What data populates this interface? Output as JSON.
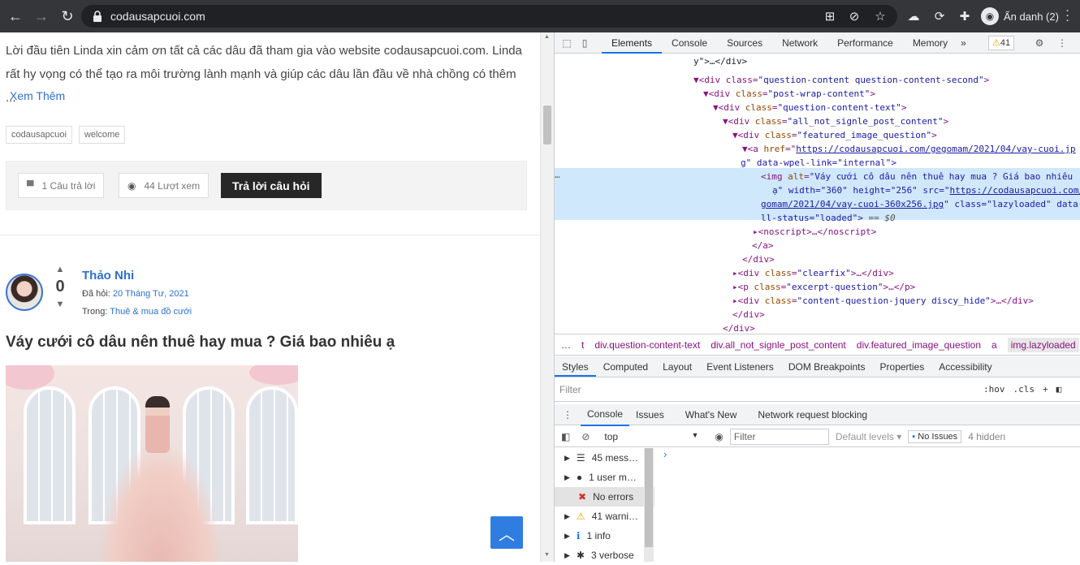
{
  "browser": {
    "url": "codausapcuoi.com",
    "profile_label": "Ẩn danh (2)"
  },
  "page": {
    "intro_text": "Lời đầu tiên Linda xin cảm ơn tất cả các dâu đã tham gia vào website codausapcuoi.com. Linda rất hy vọng có thể tạo ra môi trường lành mạnh và giúp các dâu lần đầu về nhà chồng có thêm ...",
    "read_more": "Xem Thêm",
    "tags": [
      "codausapcuoi",
      "welcome"
    ],
    "answers_btn": "1 Câu trả lời",
    "views_btn": "44 Lượt xem",
    "answer_btn": "Trả lời câu hỏi",
    "author": "Thảo Nhi",
    "vote_count": "0",
    "asked_label": "Đã hỏi:",
    "asked_date": "20 Tháng Tư, 2021",
    "in_label": "Trong:",
    "category": "Thuê & mua đồ cưới",
    "question_title": "Váy cưới cô dâu nên thuê hay mua ? Giá bao nhiêu ạ"
  },
  "devtools": {
    "tabs": [
      "Elements",
      "Console",
      "Sources",
      "Network",
      "Performance",
      "Memory"
    ],
    "more": "»",
    "warn_count": "41",
    "dom": {
      "l0": "y\">…</div>",
      "l1_tag": "<div class=",
      "l1_val": "\"question-content question-content-second\"",
      "l2_val": "\"post-wrap-content\"",
      "l3_val": "\"question-content-text\"",
      "l4_val": "\"all_not_signle_post_content\"",
      "l5_val": "\"featured_image_question\"",
      "l6_href": "https://codausapcuoi.com/gegomam/2021/04/vay-cuoi.jp",
      "l6b": "g\" data-wpel-link=\"internal\">",
      "img_alt": "\"Váy cưới cô dâu nên thuê hay mua ? Giá bao nhiêu",
      "img_l2a": "ạ\" width=\"360\" height=\"256\" src=\"",
      "img_l2b": "https://codausapcuoi.com/ge",
      "img_l3": "gomam/2021/04/vay-cuoi-360x256.jpg",
      "img_l3b": "\" class=\"lazyloaded\" data-",
      "img_l4": "ll-status=\"loaded\">",
      "img_eq": " == $0",
      "noscript": "<noscript>…</noscript>",
      "close_a": "</a>",
      "close_div": "</div>",
      "clearfix": "\"clearfix\"",
      "excerpt": "\"excerpt-question\"",
      "jquery": "\"content-question-jquery discy_hide\""
    },
    "breadcrumbs": [
      "…",
      "t",
      "div.question-content-text",
      "div.all_not_signle_post_content",
      "div.featured_image_question",
      "a",
      "img.lazyloaded"
    ],
    "subtabs": [
      "Styles",
      "Computed",
      "Layout",
      "Event Listeners",
      "DOM Breakpoints",
      "Properties",
      "Accessibility"
    ],
    "filter_placeholder": "Filter",
    "hov": ":hov",
    "cls": ".cls",
    "drawer_tabs": [
      "Console",
      "Issues",
      "What's New",
      "Network request blocking"
    ],
    "context": "top",
    "console_filter": "Filter",
    "levels": "Default levels",
    "no_issues": "No Issues",
    "hidden": "4 hidden",
    "sidebar": [
      "45 mess…",
      "1 user m…",
      "No errors",
      "41 warni…",
      "1 info",
      "3 verbose"
    ],
    "prompt": "›"
  }
}
